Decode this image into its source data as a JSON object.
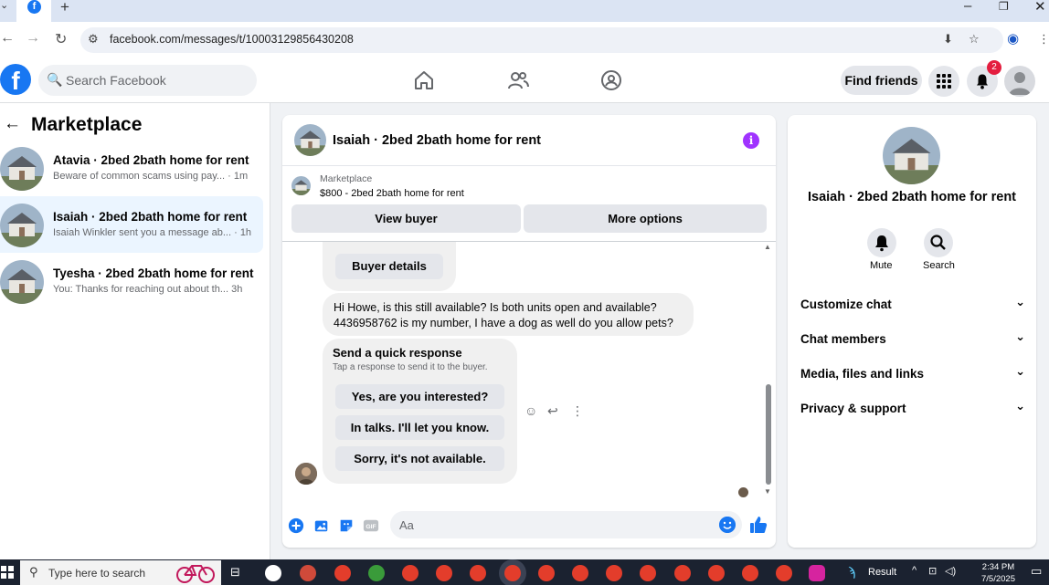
{
  "browser": {
    "url": "facebook.com/messages/t/10003129856430208",
    "new_tab": "+"
  },
  "header": {
    "search_placeholder": "Search Facebook",
    "find_friends": "Find friends",
    "notification_count": "2"
  },
  "left": {
    "title": "Marketplace",
    "conversations": [
      {
        "name": "Atavia · 2bed 2bath home for rent",
        "preview": "Beware of common scams using pay... · 1m"
      },
      {
        "name": "Isaiah · 2bed 2bath home for rent",
        "preview": "Isaiah Winkler sent you a message ab... · 1h"
      },
      {
        "name": "Tyesha · 2bed 2bath home for rent",
        "preview": "You: Thanks for reaching out about th...  3h"
      }
    ]
  },
  "chat": {
    "title": "Isaiah · 2bed 2bath home for rent",
    "marketplace_label": "Marketplace",
    "listing": "$800 - 2bed 2bath home for rent",
    "view_buyer": "View buyer",
    "more_options": "More options",
    "buyer_details": "Buyer details",
    "message_line1": "Hi Howe, is this still available? Is both units open and available?",
    "message_line2": "4436958762 is my number,  I have a dog as well do you allow pets?",
    "quick_title": "Send a quick response",
    "quick_sub": "Tap a response to send it to the buyer.",
    "quick_options": [
      "Yes, are you interested?",
      "In talks. I'll let you know.",
      "Sorry, it's not available."
    ],
    "composer_placeholder": "Aa"
  },
  "right": {
    "name": "Isaiah · 2bed 2bath home for rent",
    "mute": "Mute",
    "search": "Search",
    "sections": [
      "Customize chat",
      "Chat members",
      "Media, files and links",
      "Privacy & support"
    ]
  },
  "taskbar": {
    "search_placeholder": "Type here to search",
    "result_label": "Result",
    "time": "2:34 PM",
    "date": "7/5/2025"
  },
  "colors": {
    "brand": "#1877f2",
    "selected_row": "#ebf5ff",
    "info_button": "#a033ff",
    "notification_badge": "#e41e3f"
  }
}
